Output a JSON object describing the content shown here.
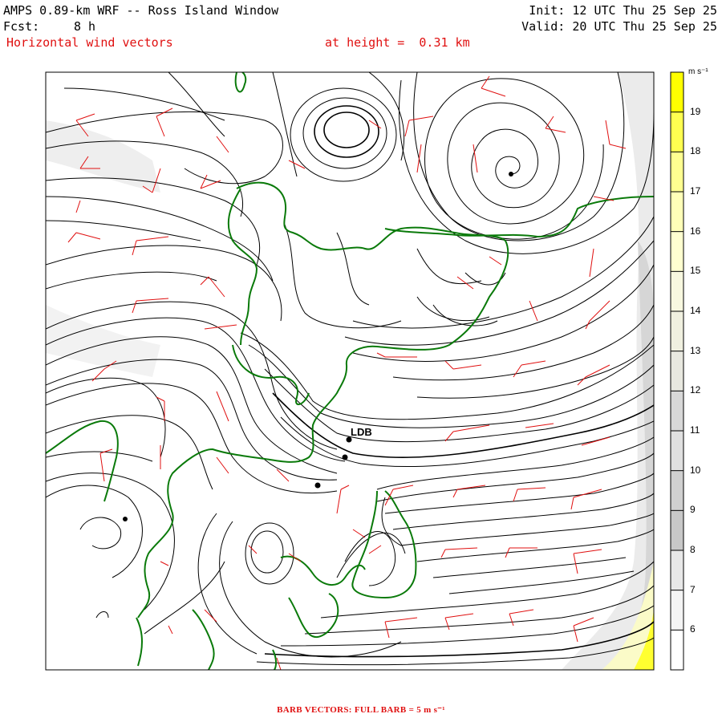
{
  "header": {
    "title": "AMPS 0.89-km WRF -- Ross Island Window",
    "init": "Init: 12 UTC Thu 25 Sep 25",
    "fcst_label": "Fcst:",
    "fcst_value": "8 h",
    "valid": "Valid: 20 UTC Thu 25 Sep 25",
    "field": "Horizontal wind vectors",
    "height": "at height =  0.31 km"
  },
  "colorbar": {
    "unit": "m s⁻¹",
    "ticks": [
      "19",
      "18",
      "17",
      "16",
      "15",
      "14",
      "13",
      "12",
      "11",
      "10",
      "9",
      "8",
      "7",
      "6"
    ],
    "colors": [
      "#ffff00",
      "#ffff50",
      "#ffff90",
      "#ffffb8",
      "#ffffd0",
      "#f8f8e0",
      "#f0f0e0",
      "#e8e8e0",
      "#d8d8d8",
      "#e0e0e0",
      "#d0d0d0",
      "#c8c8c8",
      "#e8e8e8",
      "#f4f4f4",
      "#ffffff"
    ]
  },
  "map": {
    "station_label": "LDB",
    "line_colors": {
      "streamline": "#000000",
      "coast": "#0a7a0a",
      "barb": "#e01010"
    }
  },
  "footer": "BARB VECTORS:  FULL BARB = 5 m s⁻¹"
}
